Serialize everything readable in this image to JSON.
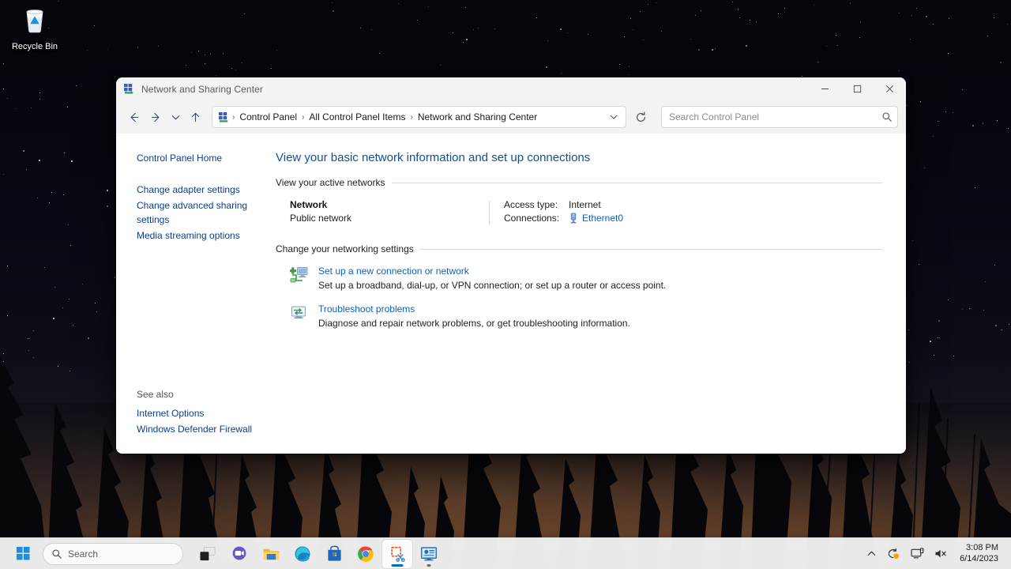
{
  "desktop": {
    "recycle_bin": {
      "label": "Recycle Bin",
      "icon": "recycle-bin-icon"
    }
  },
  "window": {
    "title": "Network and Sharing Center",
    "icon": "network-sharing-center-icon",
    "controls": {
      "minimize": "—",
      "maximize": "□",
      "close": "✕"
    },
    "toolbar": {
      "back": "back-arrow",
      "forward": "forward-arrow",
      "recent": "chevron-down",
      "up": "up-arrow",
      "refresh": "refresh",
      "breadcrumb": [
        "Control Panel",
        "All Control Panel Items",
        "Network and Sharing Center"
      ],
      "breadcrumb_separator": "›",
      "search_placeholder": "Search Control Panel"
    }
  },
  "sidebar": {
    "home": "Control Panel Home",
    "links": [
      "Change adapter settings",
      "Change advanced sharing settings",
      "Media streaming options"
    ],
    "see_also_title": "See also",
    "see_also": [
      "Internet Options",
      "Windows Defender Firewall"
    ]
  },
  "content": {
    "page_title": "View your basic network information and set up connections",
    "active_networks": {
      "heading": "View your active networks",
      "network_name": "Network",
      "network_type": "Public network",
      "access_type_label": "Access type:",
      "access_type_value": "Internet",
      "connections_label": "Connections:",
      "connections_value": "Ethernet0",
      "connections_icon": "ethernet-adapter-icon"
    },
    "networking_settings": {
      "heading": "Change your networking settings",
      "items": [
        {
          "icon": "new-connection-icon",
          "title": "Set up a new connection or network",
          "description": "Set up a broadband, dial-up, or VPN connection; or set up a router or access point."
        },
        {
          "icon": "troubleshoot-icon",
          "title": "Troubleshoot problems",
          "description": "Diagnose and repair network problems, or get troubleshooting information."
        }
      ]
    }
  },
  "taskbar": {
    "start": "windows-start-icon",
    "search_placeholder": "Search",
    "apps": [
      {
        "name": "task-view",
        "label": "Task View"
      },
      {
        "name": "chat",
        "label": "Chat"
      },
      {
        "name": "file-explorer",
        "label": "File Explorer"
      },
      {
        "name": "edge",
        "label": "Microsoft Edge"
      },
      {
        "name": "store",
        "label": "Microsoft Store"
      },
      {
        "name": "chrome",
        "label": "Google Chrome"
      },
      {
        "name": "snipping-tool",
        "label": "Snipping Tool"
      },
      {
        "name": "control-panel",
        "label": "Control Panel"
      }
    ],
    "tray": {
      "show_hidden": "show-hidden-icons",
      "network": "network-icon",
      "display": "display-icon",
      "volume": "volume-muted-icon"
    },
    "clock": {
      "time": "3:08 PM",
      "date": "6/14/2023"
    }
  },
  "colors": {
    "accent": "#0a6cbb",
    "link": "#0b63b8",
    "title_link": "#13508a",
    "sidebar_link": "#0b3f8f",
    "window_chrome": "#f3f3f3"
  }
}
